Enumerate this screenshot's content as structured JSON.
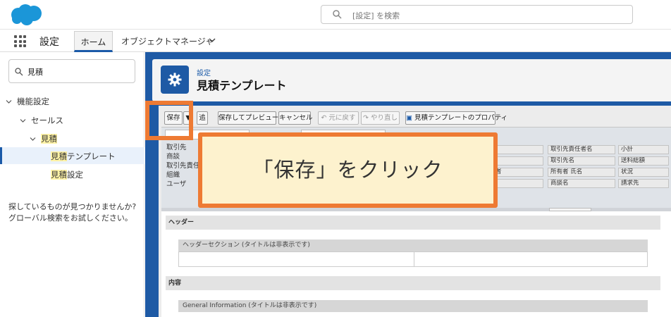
{
  "header": {
    "search_placeholder": "[設定] を検索"
  },
  "nav": {
    "app_name": "設定",
    "tabs": [
      {
        "label": "ホーム"
      },
      {
        "label": "オブジェクトマネージャ"
      }
    ]
  },
  "sidebar": {
    "quickfind_value": "見積",
    "tree": [
      {
        "label": "機能設定"
      },
      {
        "label": "セールス"
      },
      {
        "label": "見積"
      },
      {
        "label_hl": "見積",
        "label_rest": "テンプレート"
      },
      {
        "label_hl": "見積",
        "label_rest": "設定"
      }
    ],
    "no_results": "探しているものが見つかりませんか? グローバル検索をお試しください。"
  },
  "page": {
    "breadcrumb": "設定",
    "title": "見積テンプレート"
  },
  "toolbar": {
    "buttons": [
      {
        "label": "保存"
      },
      {
        "label": "▼"
      },
      {
        "label": "追"
      },
      {
        "label": "保存してプレビュー"
      },
      {
        "label": "キャンセル"
      },
      {
        "label": "元に戻す"
      },
      {
        "label": "やり直し"
      },
      {
        "label": "見積テンプレートのプロパティ"
      }
    ]
  },
  "palette": {
    "list": [
      "取引先",
      "商談",
      "取引先責任",
      "組織",
      "ユーザ"
    ],
    "cells": [
      {
        "label": ""
      },
      {
        "label": "取引先責任者名"
      },
      {
        "label": "小計"
      },
      {
        "label": ")"
      },
      {
        "label": "取引先名"
      },
      {
        "label": "送料総額"
      },
      {
        "label": "者"
      },
      {
        "label": "所有者 氏名"
      },
      {
        "label": "状況"
      },
      {
        "label": ""
      },
      {
        "label": "商談名"
      },
      {
        "label": "請求先"
      }
    ]
  },
  "layout": {
    "sections": [
      {
        "label": "ヘッダー",
        "subsection": "ヘッダーセクション (タイトルは非表示です)"
      },
      {
        "label": "内容",
        "subsection": "General Information (タイトルは非表示です)"
      }
    ]
  },
  "callout": {
    "text": "「保存」をクリック"
  },
  "colors": {
    "brand_blue": "#1e5aa5",
    "annotation_orange": "#ee7a33",
    "callout_fill": "#fdf2ce",
    "salesforce_cloud": "#1b96d8"
  }
}
